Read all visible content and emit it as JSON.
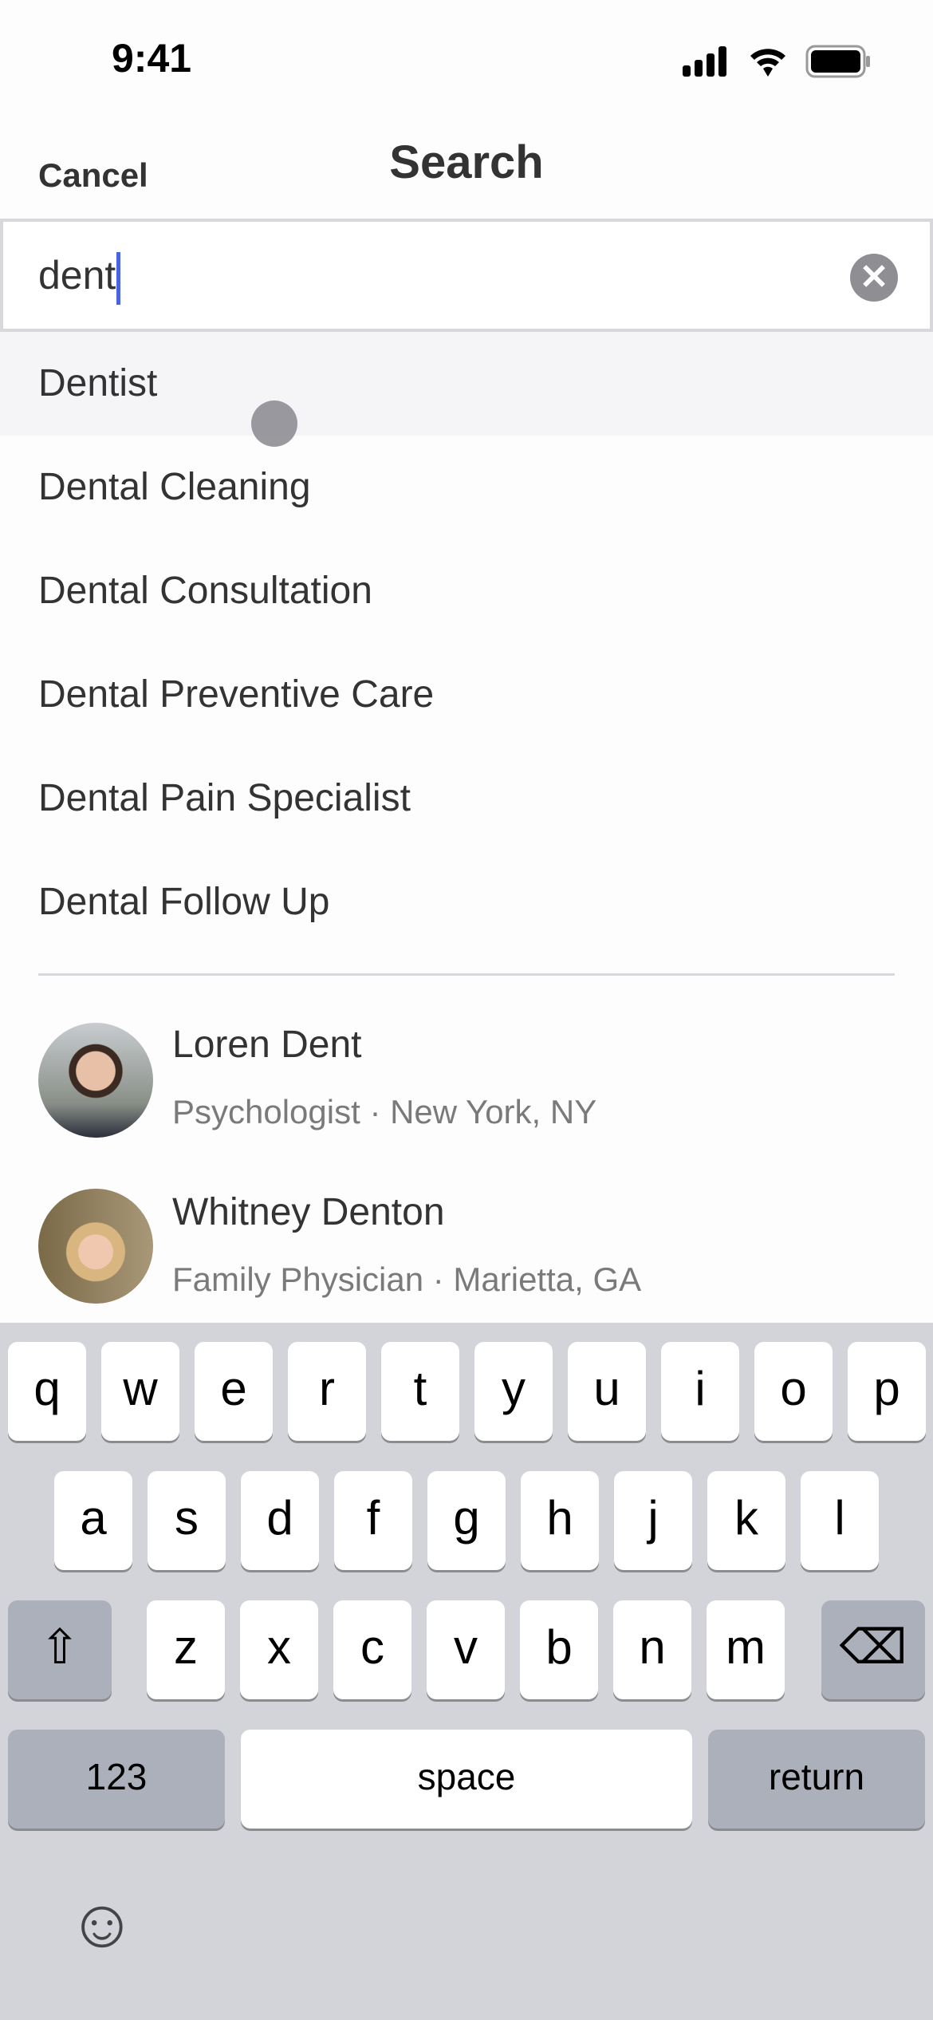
{
  "status_bar": {
    "time": "9:41",
    "icons": [
      "signal-icon",
      "wifi-icon",
      "battery-icon"
    ]
  },
  "header": {
    "cancel_label": "Cancel",
    "title": "Search"
  },
  "search": {
    "value": "dent",
    "clear_icon": "clear-icon"
  },
  "suggestions": [
    "Dentist",
    "Dental Cleaning",
    "Dental Consultation",
    "Dental Preventive Care",
    "Dental Pain Specialist",
    "Dental Follow Up"
  ],
  "providers": [
    {
      "name": "Loren Dent",
      "specialty": "Psychologist",
      "location": "New York, NY",
      "subtitle": "Psychologist · New York, NY"
    },
    {
      "name": "Whitney Denton",
      "specialty": "Family Physician",
      "location": "Marietta, GA",
      "subtitle": "Family Physician · Marietta, GA"
    }
  ],
  "keyboard": {
    "row1": [
      "q",
      "w",
      "e",
      "r",
      "t",
      "y",
      "u",
      "i",
      "o",
      "p"
    ],
    "row2": [
      "a",
      "s",
      "d",
      "f",
      "g",
      "h",
      "j",
      "k",
      "l"
    ],
    "row3": [
      "z",
      "x",
      "c",
      "v",
      "b",
      "n",
      "m"
    ],
    "numbers_label": "123",
    "space_label": "space",
    "return_label": "return",
    "shift_icon": "⇧",
    "delete_icon": "⌫",
    "emoji_icon": "☺"
  },
  "colors": {
    "caret": "#4a63e0",
    "highlight": "#f5f5f8",
    "keyboard_bg": "#d2d4da"
  }
}
